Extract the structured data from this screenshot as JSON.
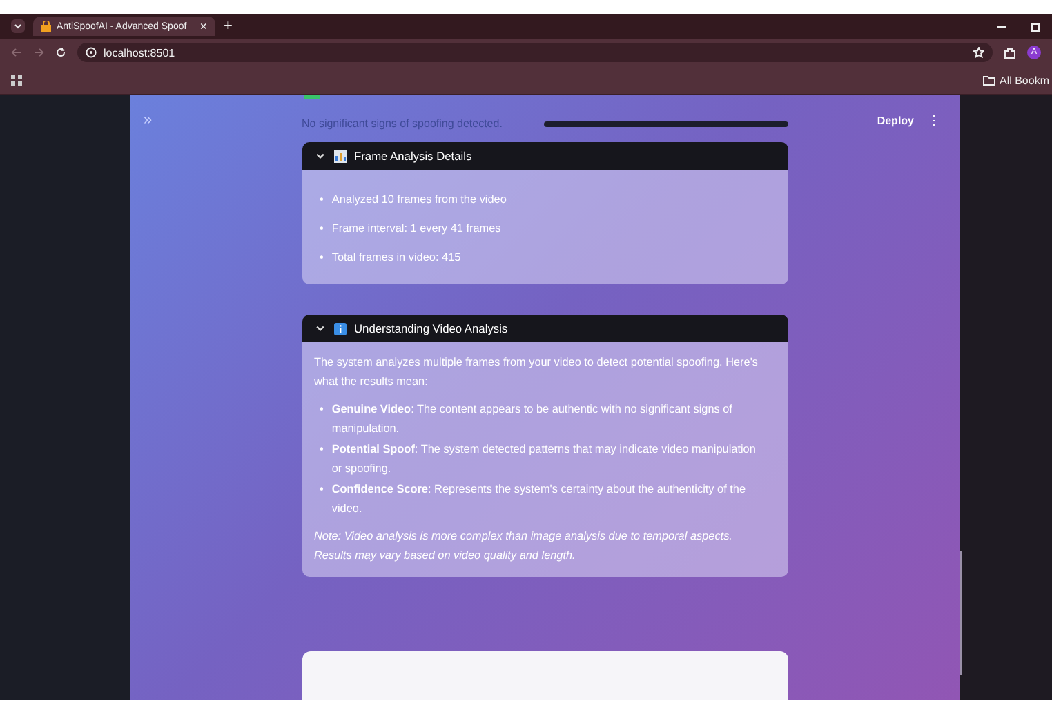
{
  "browser": {
    "tab_title": "AntiSpoofAI - Advanced Spoof",
    "tab_close": "×",
    "new_tab": "+",
    "address": "localhost:8501",
    "avatar": "A",
    "bookmarks": "All Bookm"
  },
  "app": {
    "sidebar_toggle": "»",
    "deploy": "Deploy",
    "menu": "⋮",
    "status_text": "No significant signs of spoofing detected.",
    "progress": {
      "level": 1
    }
  },
  "sections": [
    {
      "kind": "list",
      "title": "Frame Analysis Details",
      "expanded": true,
      "bullet": "•",
      "items": [
        "Analyzed 10 frames from the video",
        "Frame interval: 1 every 41 frames",
        "Total frames in video: 415"
      ]
    },
    {
      "kind": "explainer",
      "title": "Understanding Video Analysis",
      "expanded": true,
      "bullet": "•",
      "intro": "The system analyzes multiple frames from your video to detect potential spoofing. Here's what the results mean:",
      "items": [
        "**Genuine Video**: The content appears to be authentic with no significant signs of manipulation.",
        "**Potential Spoof**: The system detected patterns that may indicate video manipulation or spoofing.",
        "**Confidence Score**: Represents the system's certainty about the authenticity of the video."
      ],
      "note": "Note: Video analysis is more complex than image analysis due to temporal aspects. Results may vary based on video quality and length."
    }
  ]
}
